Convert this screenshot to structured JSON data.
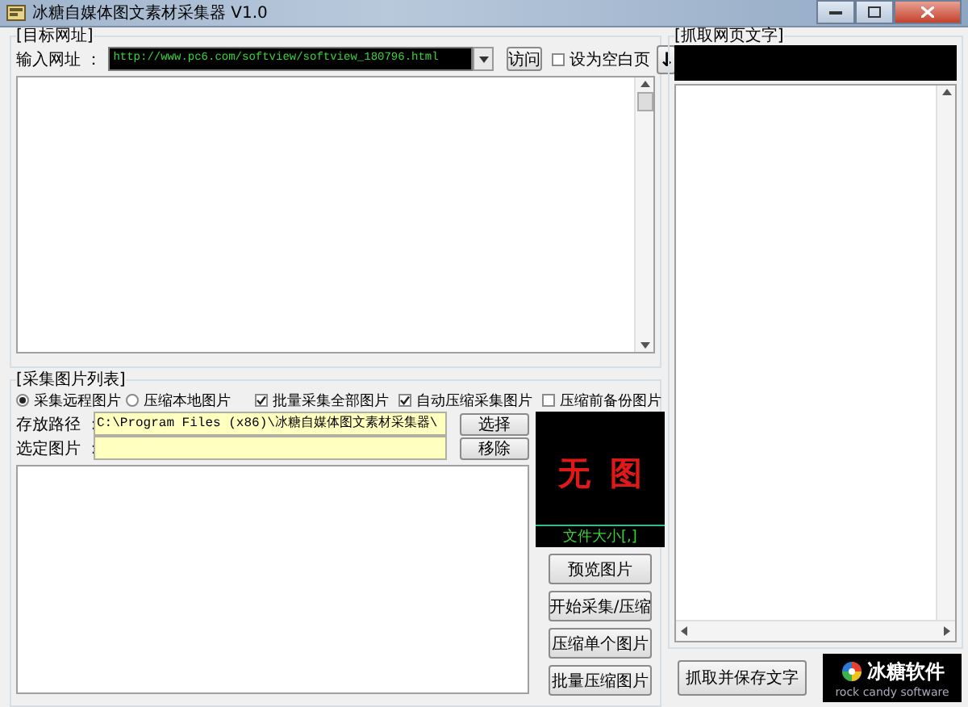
{
  "window": {
    "title": "冰糖自媒体图文素材采集器 V1.0"
  },
  "url_group": {
    "title": "[目标网址]",
    "url_label": "输入网址 ：",
    "url_value": "http://www.pc6.com/softview/softview_180796.html",
    "visit_button": "访问",
    "blank_page": {
      "label": "设为空白页",
      "checked": false
    },
    "down_button": "↓"
  },
  "image_group": {
    "title": "[采集图片列表]",
    "modes": [
      {
        "label": "采集远程图片",
        "selected": true
      },
      {
        "label": "压缩本地图片",
        "selected": false
      }
    ],
    "options": [
      {
        "label": "批量采集全部图片",
        "checked": true
      },
      {
        "label": "自动压缩采集图片",
        "checked": true
      },
      {
        "label": "压缩前备份图片",
        "checked": false
      }
    ],
    "path_label": "存放路径 ：",
    "path_value": "C:\\Program Files (x86)\\冰糖自媒体图文素材采集器\\",
    "choose_button": "选择",
    "selected_label": "选定图片 ：",
    "remove_button": "移除",
    "preview": {
      "placeholder": "无图",
      "file_size": "文件大小[,]"
    },
    "actions": [
      "预览图片",
      "开始采集/压缩",
      "压缩单个图片",
      "批量压缩图片"
    ]
  },
  "text_group": {
    "title": "[抓取网页文字]",
    "save_button": "抓取并保存文字"
  },
  "logo": {
    "name": "冰糖软件",
    "tagline": "rock candy software"
  }
}
